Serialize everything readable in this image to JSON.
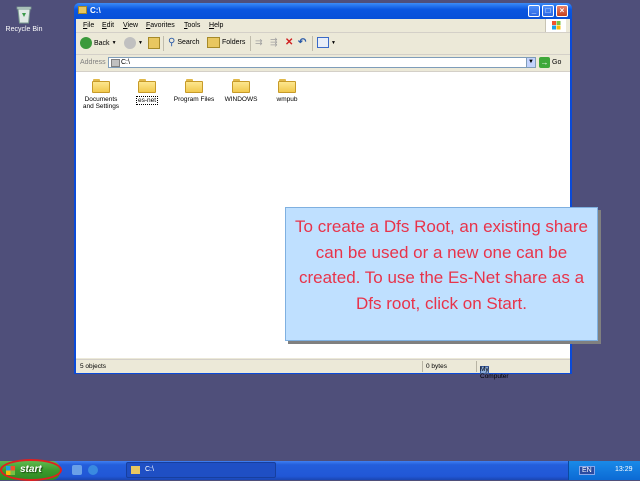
{
  "desktop": {
    "recycle_bin_label": "Recycle Bin"
  },
  "window": {
    "title": "C:\\",
    "menu": [
      "File",
      "Edit",
      "View",
      "Favorites",
      "Tools",
      "Help"
    ],
    "toolbar": {
      "back": "Back",
      "search": "Search",
      "folders": "Folders"
    },
    "address": {
      "label": "Address",
      "value": "C:\\",
      "go": "Go"
    },
    "folders": [
      {
        "line1": "Documents",
        "line2": "and Settings"
      },
      {
        "line1": "es-net",
        "line2": ""
      },
      {
        "line1": "Program Files",
        "line2": ""
      },
      {
        "line1": "WINDOWS",
        "line2": ""
      },
      {
        "line1": "wmpub",
        "line2": ""
      }
    ],
    "status": {
      "objects": "5 objects",
      "size": "0 bytes",
      "location": "My Computer"
    }
  },
  "callout": {
    "text": "To create a Dfs Root, an existing share can be used or a new one can be created. To use the Es-Net share as a Dfs root, click on Start."
  },
  "taskbar": {
    "start_label": "start",
    "task_item": "C:\\",
    "language": "EN",
    "clock": "13:29"
  },
  "colors": {
    "desktop": "#4f4f7a",
    "callout_text": "#e8334a",
    "callout_bg": "#bfe0ff",
    "highlight_ring": "#e02020"
  }
}
